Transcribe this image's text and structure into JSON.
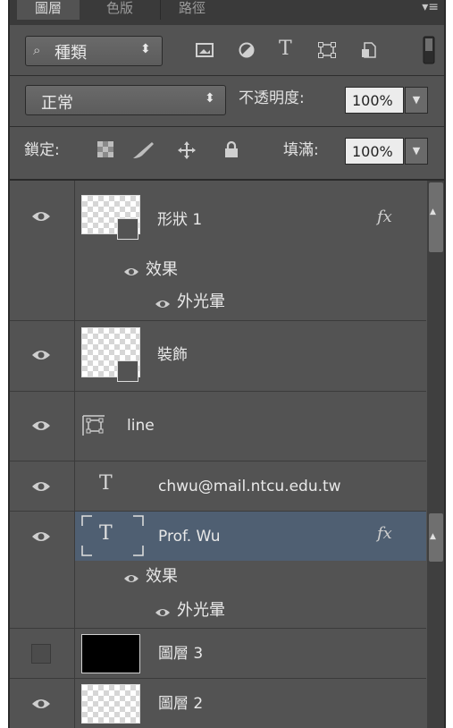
{
  "tabs": [
    "圖層",
    "色版",
    "路徑"
  ],
  "panel_menu": "▾≡",
  "filter": {
    "label": "種類",
    "arrows": "⬍"
  },
  "filter_icons": [
    "image-filter-icon",
    "adjustment-filter-icon",
    "type-filter-icon",
    "shape-filter-icon",
    "smart-object-filter-icon",
    "filter-toggle-icon"
  ],
  "type_letter": "T",
  "blend": {
    "mode": "正常",
    "arrows": "⬍",
    "opacity_label": "不透明度:",
    "opacity_value": "100%"
  },
  "lock": {
    "label": "鎖定:",
    "fill_label": "填滿:",
    "fill_value": "100%"
  },
  "layers": [
    {
      "name": "形狀 1",
      "fx": "fx",
      "effects_label": "效果",
      "effect": "外光暈"
    },
    {
      "name": "裝飾"
    },
    {
      "name": "line"
    },
    {
      "name": "chwu@mail.ntcu.edu.tw",
      "type_glyph": "T"
    },
    {
      "name": "Prof. Wu",
      "type_glyph": "T",
      "fx": "fx",
      "effects_label": "效果",
      "effect": "外光暈",
      "selected": true
    },
    {
      "name": "圖層 3",
      "visible": false
    },
    {
      "name": "圖層 2"
    }
  ],
  "colors": {
    "panel": "#535353",
    "selected": "#4f5f72",
    "field": "#ececec"
  }
}
